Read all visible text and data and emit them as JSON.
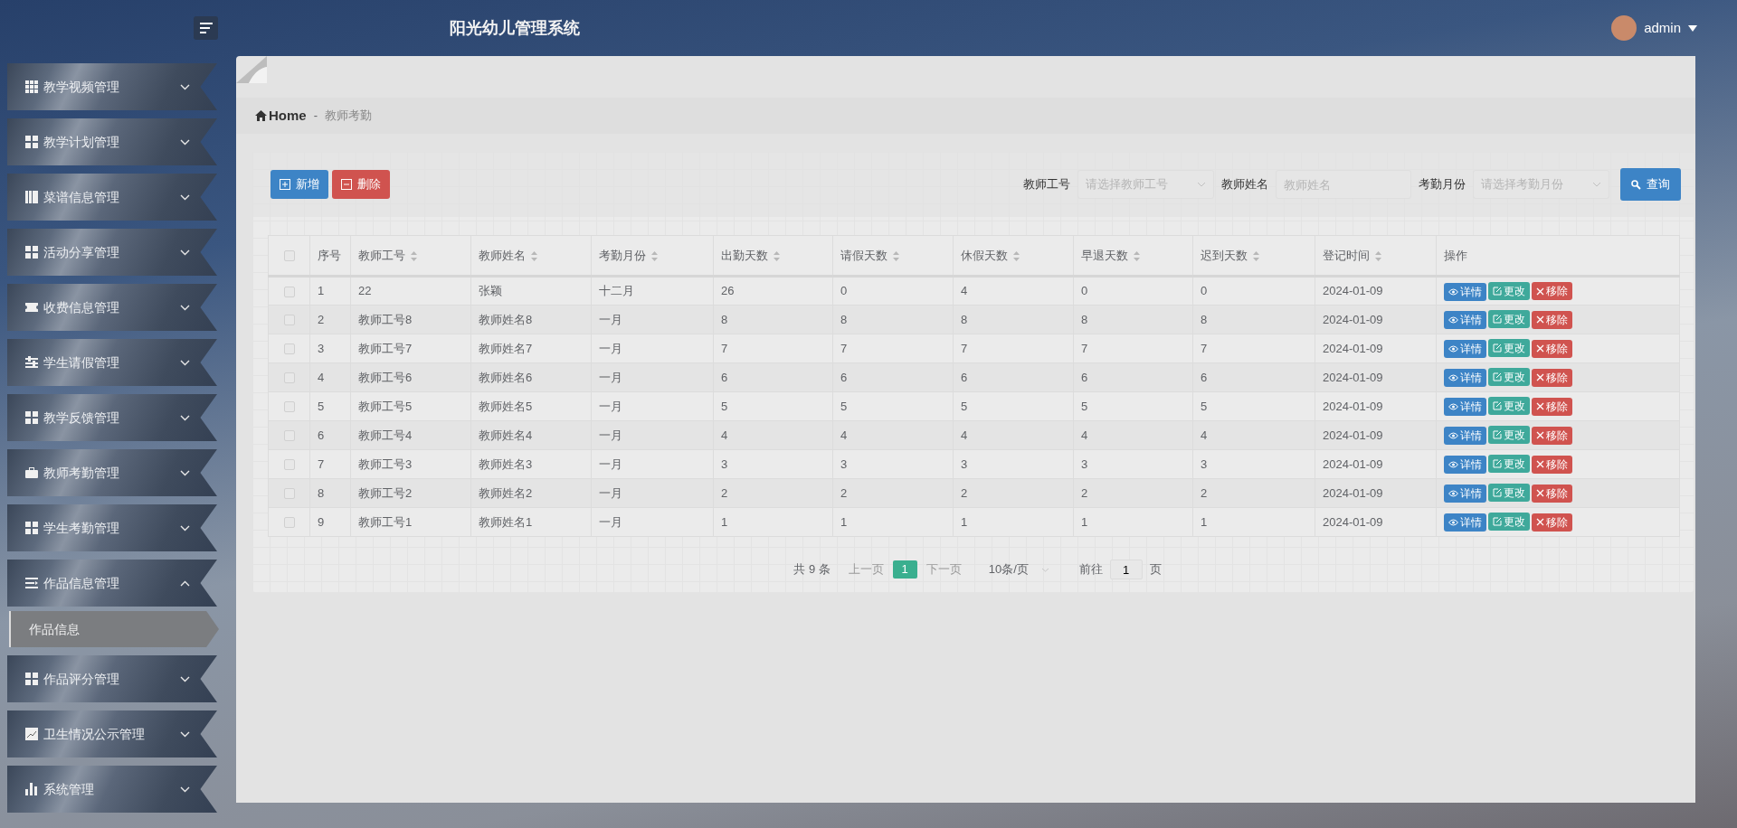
{
  "header": {
    "title": "阳光幼儿管理系统",
    "user": "admin"
  },
  "sidebar": {
    "items": [
      {
        "label": "教学视频管理",
        "expanded": false
      },
      {
        "label": "教学计划管理",
        "expanded": false
      },
      {
        "label": "菜谱信息管理",
        "expanded": false
      },
      {
        "label": "活动分享管理",
        "expanded": false
      },
      {
        "label": "收费信息管理",
        "expanded": false
      },
      {
        "label": "学生请假管理",
        "expanded": false
      },
      {
        "label": "教学反馈管理",
        "expanded": false
      },
      {
        "label": "教师考勤管理",
        "expanded": false
      },
      {
        "label": "学生考勤管理",
        "expanded": false
      },
      {
        "label": "作品信息管理",
        "expanded": true,
        "children": [
          {
            "label": "作品信息",
            "selected": true
          }
        ]
      },
      {
        "label": "作品评分管理",
        "expanded": false
      },
      {
        "label": "卫生情况公示管理",
        "expanded": false
      },
      {
        "label": "系统管理",
        "expanded": false
      }
    ]
  },
  "breadcrumb": {
    "home": "Home",
    "separator": "-",
    "current": "教师考勤"
  },
  "toolbar": {
    "add": "新增",
    "delete": "删除"
  },
  "filters": [
    {
      "kind": "select",
      "label": "教师工号",
      "placeholder": "请选择教师工号"
    },
    {
      "kind": "input",
      "label": "教师姓名",
      "placeholder": "教师姓名"
    },
    {
      "kind": "select",
      "label": "考勤月份",
      "placeholder": "请选择考勤月份"
    }
  ],
  "search_button": "查询",
  "table": {
    "select_all_checked": false,
    "columns": [
      {
        "label": "序号",
        "sortable": false
      },
      {
        "label": "教师工号",
        "sortable": true
      },
      {
        "label": "教师姓名",
        "sortable": true
      },
      {
        "label": "考勤月份",
        "sortable": true
      },
      {
        "label": "出勤天数",
        "sortable": true
      },
      {
        "label": "请假天数",
        "sortable": true
      },
      {
        "label": "休假天数",
        "sortable": true
      },
      {
        "label": "早退天数",
        "sortable": true
      },
      {
        "label": "迟到天数",
        "sortable": true
      },
      {
        "label": "登记时间",
        "sortable": true
      },
      {
        "label": "操作",
        "sortable": false
      }
    ],
    "rows": [
      {
        "checked": false,
        "cells": [
          "1",
          "22",
          "张颖",
          "十二月",
          "26",
          "0",
          "4",
          "0",
          "0",
          "2024-01-09"
        ],
        "actions": [
          "详情",
          "更改",
          "移除"
        ]
      },
      {
        "checked": false,
        "cells": [
          "2",
          "教师工号8",
          "教师姓名8",
          "一月",
          "8",
          "8",
          "8",
          "8",
          "8",
          "2024-01-09"
        ],
        "actions": [
          "详情",
          "更改",
          "移除"
        ]
      },
      {
        "checked": false,
        "cells": [
          "3",
          "教师工号7",
          "教师姓名7",
          "一月",
          "7",
          "7",
          "7",
          "7",
          "7",
          "2024-01-09"
        ],
        "actions": [
          "详情",
          "更改",
          "移除"
        ]
      },
      {
        "checked": false,
        "cells": [
          "4",
          "教师工号6",
          "教师姓名6",
          "一月",
          "6",
          "6",
          "6",
          "6",
          "6",
          "2024-01-09"
        ],
        "actions": [
          "详情",
          "更改",
          "移除"
        ]
      },
      {
        "checked": false,
        "cells": [
          "5",
          "教师工号5",
          "教师姓名5",
          "一月",
          "5",
          "5",
          "5",
          "5",
          "5",
          "2024-01-09"
        ],
        "actions": [
          "详情",
          "更改",
          "移除"
        ]
      },
      {
        "checked": false,
        "cells": [
          "6",
          "教师工号4",
          "教师姓名4",
          "一月",
          "4",
          "4",
          "4",
          "4",
          "4",
          "2024-01-09"
        ],
        "actions": [
          "详情",
          "更改",
          "移除"
        ]
      },
      {
        "checked": false,
        "cells": [
          "7",
          "教师工号3",
          "教师姓名3",
          "一月",
          "3",
          "3",
          "3",
          "3",
          "3",
          "2024-01-09"
        ],
        "actions": [
          "详情",
          "更改",
          "移除"
        ]
      },
      {
        "checked": false,
        "cells": [
          "8",
          "教师工号2",
          "教师姓名2",
          "一月",
          "2",
          "2",
          "2",
          "2",
          "2",
          "2024-01-09"
        ],
        "actions": [
          "详情",
          "更改",
          "移除"
        ]
      },
      {
        "checked": false,
        "cells": [
          "9",
          "教师工号1",
          "教师姓名1",
          "一月",
          "1",
          "1",
          "1",
          "1",
          "1",
          "2024-01-09"
        ],
        "actions": [
          "详情",
          "更改",
          "移除"
        ]
      }
    ]
  },
  "pagination": {
    "total": "共 9 条",
    "prev": "上一页",
    "pages": [
      {
        "label": "1",
        "selected": true
      }
    ],
    "next": "下一页",
    "page_size": "10条/页",
    "goto": "前往",
    "goto_value": "1",
    "page_unit": "页"
  }
}
